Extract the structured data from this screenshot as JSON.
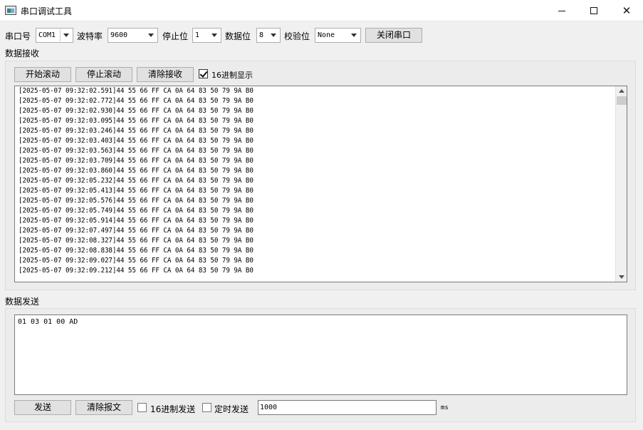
{
  "window": {
    "title": "串口调试工具"
  },
  "settings": {
    "port_label": "串口号",
    "port_value": "COM1",
    "baud_label": "波特率",
    "baud_value": "9600",
    "stop_label": "停止位",
    "stop_value": "1",
    "data_label": "数据位",
    "data_value": "8",
    "parity_label": "校验位",
    "parity_value": "None",
    "toggle_port_label": "关闭串口"
  },
  "receive": {
    "group_title": "数据接收",
    "start_scroll_label": "开始滚动",
    "stop_scroll_label": "停止滚动",
    "clear_receive_label": "清除接收",
    "hex_display_label": "16进制显示",
    "hex_display_checked": true,
    "lines": [
      "[2025-05-07 09:32:02.591]44 55 66 FF CA 0A 64 83 50 79 9A B0",
      "[2025-05-07 09:32:02.772]44 55 66 FF CA 0A 64 83 50 79 9A B0",
      "[2025-05-07 09:32:02.930]44 55 66 FF CA 0A 64 83 50 79 9A B0",
      "[2025-05-07 09:32:03.095]44 55 66 FF CA 0A 64 83 50 79 9A B0",
      "[2025-05-07 09:32:03.246]44 55 66 FF CA 0A 64 83 50 79 9A B0",
      "[2025-05-07 09:32:03.403]44 55 66 FF CA 0A 64 83 50 79 9A B0",
      "[2025-05-07 09:32:03.563]44 55 66 FF CA 0A 64 83 50 79 9A B0",
      "[2025-05-07 09:32:03.709]44 55 66 FF CA 0A 64 83 50 79 9A B0",
      "[2025-05-07 09:32:03.860]44 55 66 FF CA 0A 64 83 50 79 9A B0",
      "[2025-05-07 09:32:05.232]44 55 66 FF CA 0A 64 83 50 79 9A B0",
      "[2025-05-07 09:32:05.413]44 55 66 FF CA 0A 64 83 50 79 9A B0",
      "[2025-05-07 09:32:05.576]44 55 66 FF CA 0A 64 83 50 79 9A B0",
      "[2025-05-07 09:32:05.749]44 55 66 FF CA 0A 64 83 50 79 9A B0",
      "[2025-05-07 09:32:05.914]44 55 66 FF CA 0A 64 83 50 79 9A B0",
      "[2025-05-07 09:32:07.497]44 55 66 FF CA 0A 64 83 50 79 9A B0",
      "[2025-05-07 09:32:08.327]44 55 66 FF CA 0A 64 83 50 79 9A B0",
      "[2025-05-07 09:32:08.838]44 55 66 FF CA 0A 64 83 50 79 9A B0",
      "[2025-05-07 09:32:09.027]44 55 66 FF CA 0A 64 83 50 79 9A B0",
      "[2025-05-07 09:32:09.212]44 55 66 FF CA 0A 64 83 50 79 9A B0"
    ]
  },
  "send": {
    "group_title": "数据发送",
    "message_text": "01 03 01 00 AD",
    "send_label": "发送",
    "clear_message_label": "清除报文",
    "hex_send_label": "16进制发送",
    "hex_send_checked": false,
    "timed_send_label": "定时发送",
    "timed_send_checked": false,
    "interval_value": "1000",
    "interval_unit": "ms"
  }
}
